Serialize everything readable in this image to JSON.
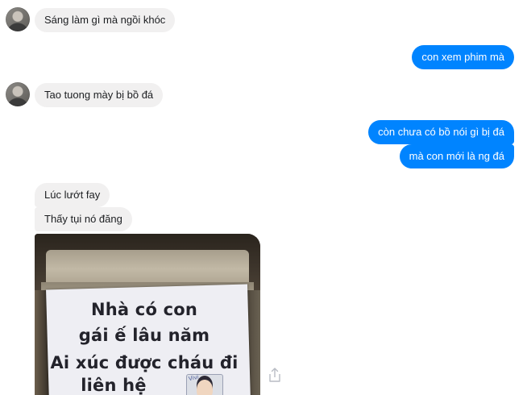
{
  "conversation": {
    "messages": [
      {
        "sender": "other",
        "text": "Sáng làm gì mà ngồi khóc"
      },
      {
        "sender": "me",
        "text": "con xem phim mà"
      },
      {
        "sender": "other",
        "text": "Tao tuong mày bị bồ đá"
      },
      {
        "sender": "me",
        "text": "còn chưa có bồ nói gì bị đá"
      },
      {
        "sender": "me",
        "text": "mà con mới là ng đá"
      },
      {
        "sender": "other",
        "text": "Lúc lướt fay"
      },
      {
        "sender": "other",
        "text": "Thấy tụi nó đăng"
      }
    ],
    "photo": {
      "sign_lines": [
        "Nhà có con",
        "gái ế lâu năm",
        "Ai xúc được cháu đi",
        "liên hệ"
      ],
      "sticker_text": "Vivi"
    }
  },
  "colors": {
    "outgoing_bubble": "#0084ff",
    "incoming_bubble": "#f1f0f0"
  },
  "icons": {
    "share": "share-icon",
    "avatar": "contact-avatar"
  }
}
